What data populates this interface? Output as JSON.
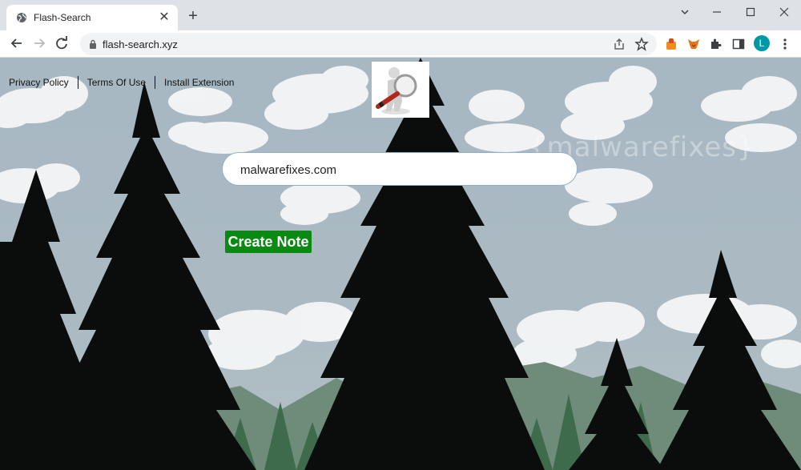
{
  "browser": {
    "tab_title": "Flash-Search",
    "tab_close": "✕",
    "new_tab": "+",
    "url": "flash-search.xyz",
    "profile_initial": "L"
  },
  "page": {
    "links": [
      "Privacy Policy",
      "Terms Of Use",
      "Install Extension"
    ],
    "search_value": "malwarefixes.com",
    "create_note_label": "Create Note",
    "watermark": "{malwarefixes}"
  },
  "colors": {
    "button_green": "#0b8a13",
    "sky": "#a8b8c2",
    "profile_badge": "#0097a7"
  }
}
